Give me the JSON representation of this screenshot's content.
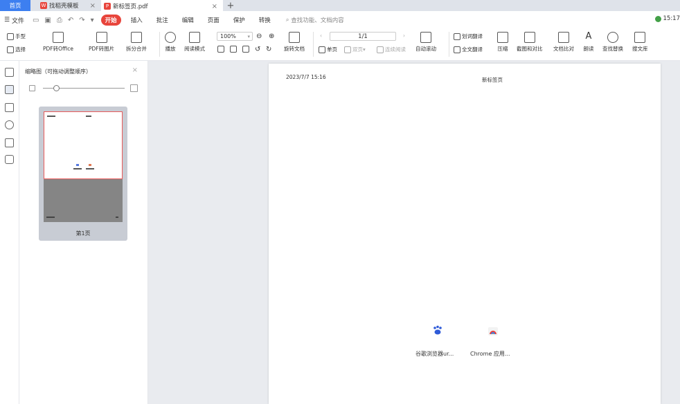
{
  "tabs": {
    "home": "首页",
    "templates": "找稻壳模板",
    "document": "新标签页.pdf",
    "new_tab": "+"
  },
  "menubar": {
    "file": "文件",
    "items": [
      "开始",
      "插入",
      "批注",
      "编辑",
      "页面",
      "保护",
      "转换"
    ],
    "search_placeholder": "查找功能、文档内容",
    "time": "15:17"
  },
  "ribbon": {
    "hand": "手型",
    "select": "选择",
    "pdf_to_office": "PDF转Office",
    "pdf_to_image": "PDF转图片",
    "split_merge": "拆分合并",
    "play": "播放",
    "read_mode": "阅读模式",
    "zoom": "100%",
    "rotate": "旋转文档",
    "page_indicator": "1/1",
    "single_page": "单页",
    "double_page": "双页",
    "continuous": "连续阅读",
    "auto_scroll": "自动滚动",
    "word_translate": "划词翻译",
    "full_translate": "全文翻译",
    "compress": "压缩",
    "screenshot_compare": "截图和对比",
    "doc_compare": "文档比对",
    "read_aloud": "朗读",
    "find_replace": "查找替换",
    "search_library": "搜文库"
  },
  "thumbnail_panel": {
    "title": "缩略图（可拖动调整顺序）",
    "page_label": "第1页"
  },
  "page": {
    "date": "2023/7/7 15:16",
    "title": "新标签页",
    "shortcut1": "谷歌浏览器ur...",
    "shortcut2": "Chrome 应用..."
  }
}
